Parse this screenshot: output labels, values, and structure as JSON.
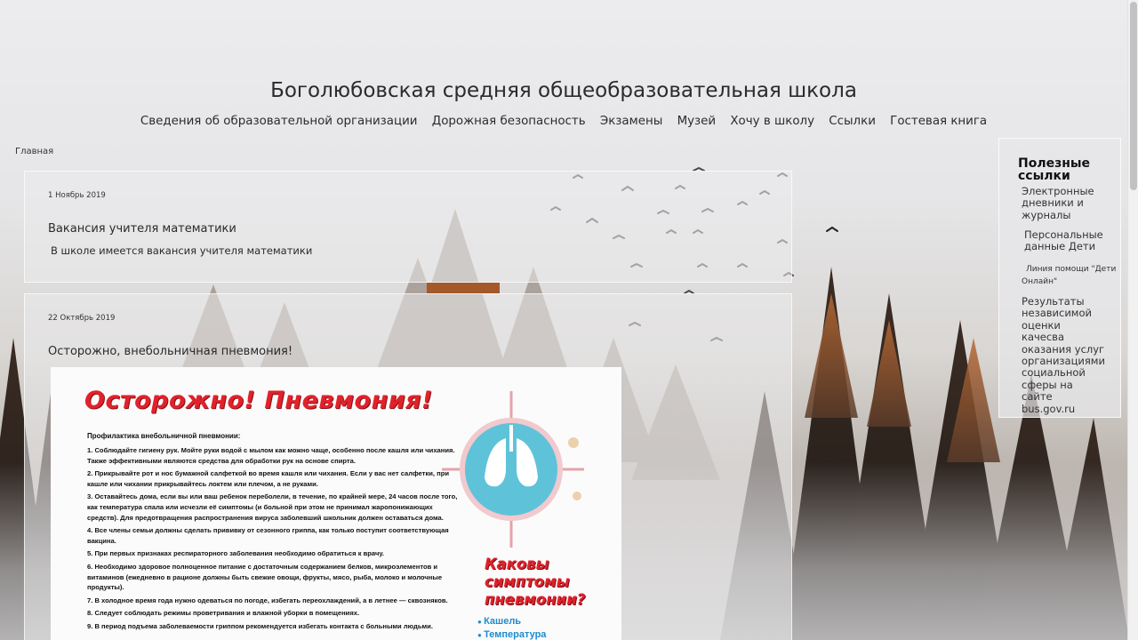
{
  "site": {
    "title": "Боголюбовская средняя общеобразовательная школа"
  },
  "nav": {
    "items": [
      "Сведения об образовательной организации",
      "Дорожная безопасность",
      "Экзамены",
      "Музей",
      "Хочу в школу",
      "Ссылки",
      "Гостевая книга"
    ]
  },
  "breadcrumb": "Главная",
  "posts": [
    {
      "date": "1 Ноябрь 2019",
      "title": "Вакансия учителя математики",
      "text": "В школе имеется вакансия учителя математики"
    },
    {
      "date": "22 Октябрь 2019",
      "title": "Осторожно, внебольничная пневмония!"
    }
  ],
  "poster": {
    "headline": "Осторожно! Пневмония!",
    "intro": "Профилактика внебольничной пневмонии:",
    "items": [
      "1. Соблюдайте гигиену рук. Мойте руки водой с мылом как можно чаще, особенно после кашля или чихания. Также эффективными являются средства для обработки рук на основе спирта.",
      "2. Прикрывайте рот и нос бумажной салфеткой во время кашля или чихания. Если у вас нет салфетки, при кашле или чихании прикрывайтесь локтем или плечом, а не руками.",
      "3. Оставайтесь дома, если вы или ваш ребенок переболели, в течение, по крайней мере, 24 часов после того, как температура спала или исчезли её симптомы (и больной при этом не принимал жаропонижающих средств). Для предотвращения распространения вируса заболевший школьник должен оставаться дома.",
      "4. Все члены семьи должны сделать прививку от сезонного гриппа, как только поступит соответствующая вакцина.",
      "5. При первых признаках респираторного заболевания необходимо обратиться к врачу.",
      "6. Необходимо здоровое полноценное питание с достаточным содержанием белков, микроэлементов и витаминов (ежедневно в рационе должны быть свежие овощи, фрукты, мясо, рыба, молоко и молочные продукты).",
      "7. В холодное время года нужно одеваться по погоде, избегать переохлаждений, а в летнее — сквозняков.",
      "8. Следует соблюдать режимы проветривания и влажной уборки в помещениях.",
      "9. В период подъема заболеваемости гриппом рекомендуется избегать контакта с больными людьми."
    ],
    "symptoms_title": "Каковы симптомы пневмонии?",
    "symptoms": [
      "Кашель",
      "Температура"
    ]
  },
  "sidebar": {
    "title": "Полезные ссылки",
    "links": [
      "Электронные дневники и журналы",
      "Персональные данные Дети",
      "Линия помощи \"Дети Онлайн\"",
      "Результаты независимой оценки качесва оказания услуг организациями социальной сферы на сайте bus.gov.ru"
    ]
  },
  "colors": {
    "poster_red": "#e1222b",
    "poster_blue": "#1f8ccf"
  }
}
